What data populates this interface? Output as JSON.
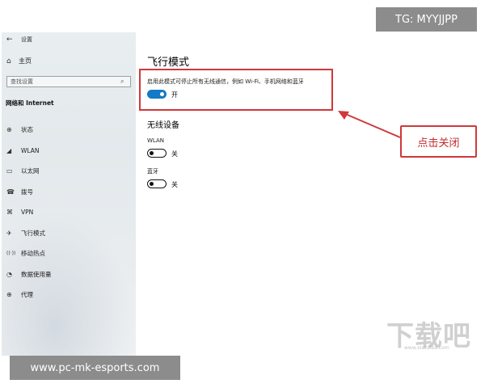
{
  "window": {
    "title": "设置",
    "back_glyph": "←"
  },
  "sidebar": {
    "home_label": "主页",
    "search_placeholder": "查找设置",
    "section_title": "网络和 Internet",
    "items": [
      {
        "icon": "globe-icon",
        "glyph": "⊕",
        "label": "状态"
      },
      {
        "icon": "wifi-icon",
        "glyph": "◢",
        "label": "WLAN"
      },
      {
        "icon": "ethernet-icon",
        "glyph": "▭",
        "label": "以太网"
      },
      {
        "icon": "dialup-icon",
        "glyph": "☎",
        "label": "拨号"
      },
      {
        "icon": "vpn-icon",
        "glyph": "⌘",
        "label": "VPN"
      },
      {
        "icon": "airplane-icon",
        "glyph": "✈",
        "label": "飞行模式"
      },
      {
        "icon": "hotspot-icon",
        "glyph": "((·))",
        "label": "移动热点"
      },
      {
        "icon": "data-usage-icon",
        "glyph": "◔",
        "label": "数据使用量"
      },
      {
        "icon": "proxy-icon",
        "glyph": "⊕",
        "label": "代理"
      }
    ]
  },
  "main": {
    "heading": "飞行模式",
    "description": "启用此模式可停止所有无线通信，例如 Wi-Fi、手机网络和蓝牙",
    "airplane_toggle": {
      "state": "on",
      "label": "开"
    },
    "wireless_heading": "无线设备",
    "wlan": {
      "label": "WLAN",
      "state": "off",
      "state_label": "关"
    },
    "bluetooth": {
      "label": "蓝牙",
      "state": "off",
      "state_label": "关"
    }
  },
  "annotation": {
    "callout_text": "点击关闭",
    "color": "#d0383a"
  },
  "overlays": {
    "tg": "TG: MYYJJPP",
    "site": "www.pc-mk-esports.com",
    "watermark": "下载吧",
    "watermark_sub": "www.xiazaiba.com"
  },
  "colors": {
    "accent": "#1479c6",
    "sidebar_bg": "#e6ebee"
  }
}
